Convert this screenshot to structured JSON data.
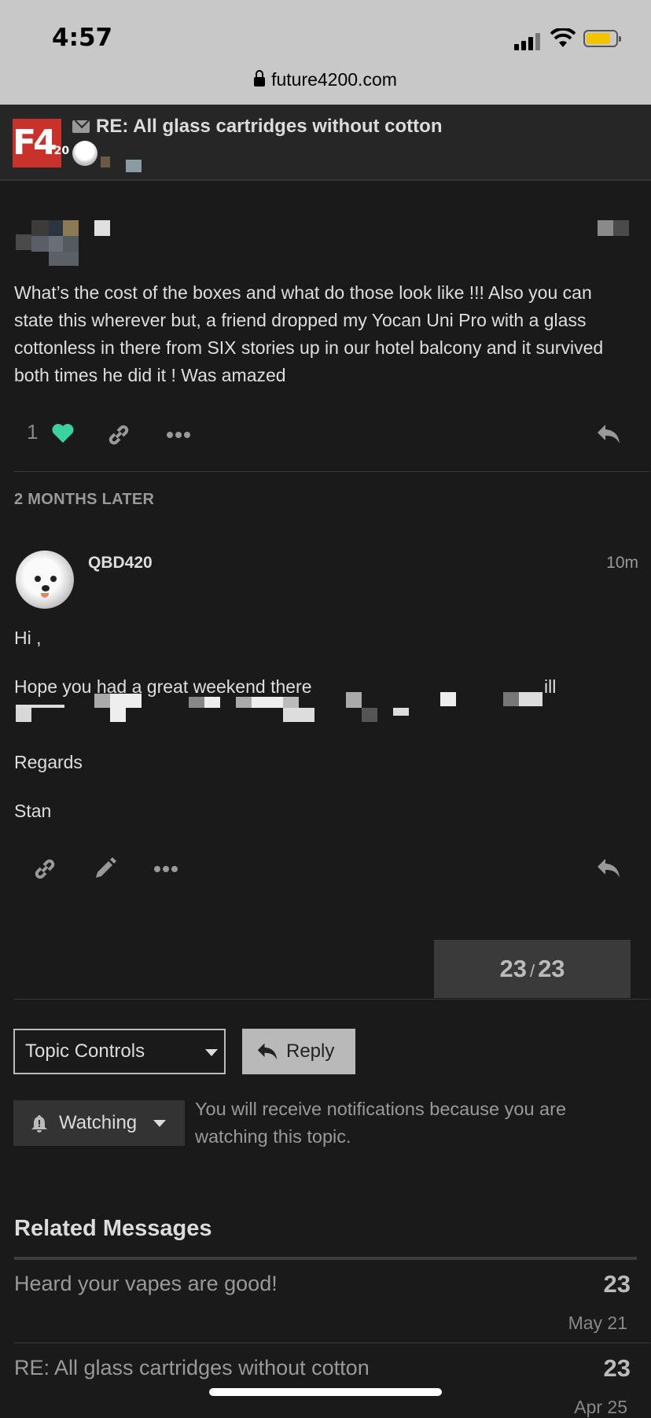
{
  "status_bar": {
    "time": "4:57"
  },
  "browser": {
    "url": "future4200.com"
  },
  "header": {
    "logo_text": "F420",
    "title": "RE: All glass cartridges without cotton"
  },
  "post1": {
    "body": "What’s the cost of the boxes and what do those look like !!! Also you can state this wherever but, a friend dropped my Yocan Uni Pro with a glass cottonless in there from SIX stories up in our hotel balcony and it survived both times he did it ! Was amazed",
    "like_count": "1"
  },
  "time_gap": "2 MONTHS LATER",
  "post2": {
    "username": "QBD420",
    "time": "10m",
    "greeting": "Hi ,",
    "line1": "Hope you had a great weekend there",
    "line1_tail": "ill",
    "regards": "Regards",
    "signature": "Stan"
  },
  "progress": {
    "current": "23",
    "separator": "/",
    "total": "23"
  },
  "controls": {
    "topic_controls": "Topic Controls",
    "reply": "Reply",
    "watching": "Watching",
    "watch_desc": "You will receive notifications because you are watching this topic."
  },
  "related": {
    "title": "Related Messages",
    "items": [
      {
        "title": "Heard your vapes are good!",
        "count": "23",
        "date": "May 21"
      },
      {
        "title": "RE: All glass cartridges without cotton",
        "count": "23",
        "date": "Apr 25"
      }
    ]
  },
  "colors": {
    "accent_like": "#3bd1a0",
    "logo_red": "#c8322a",
    "battery": "#f5c400"
  }
}
